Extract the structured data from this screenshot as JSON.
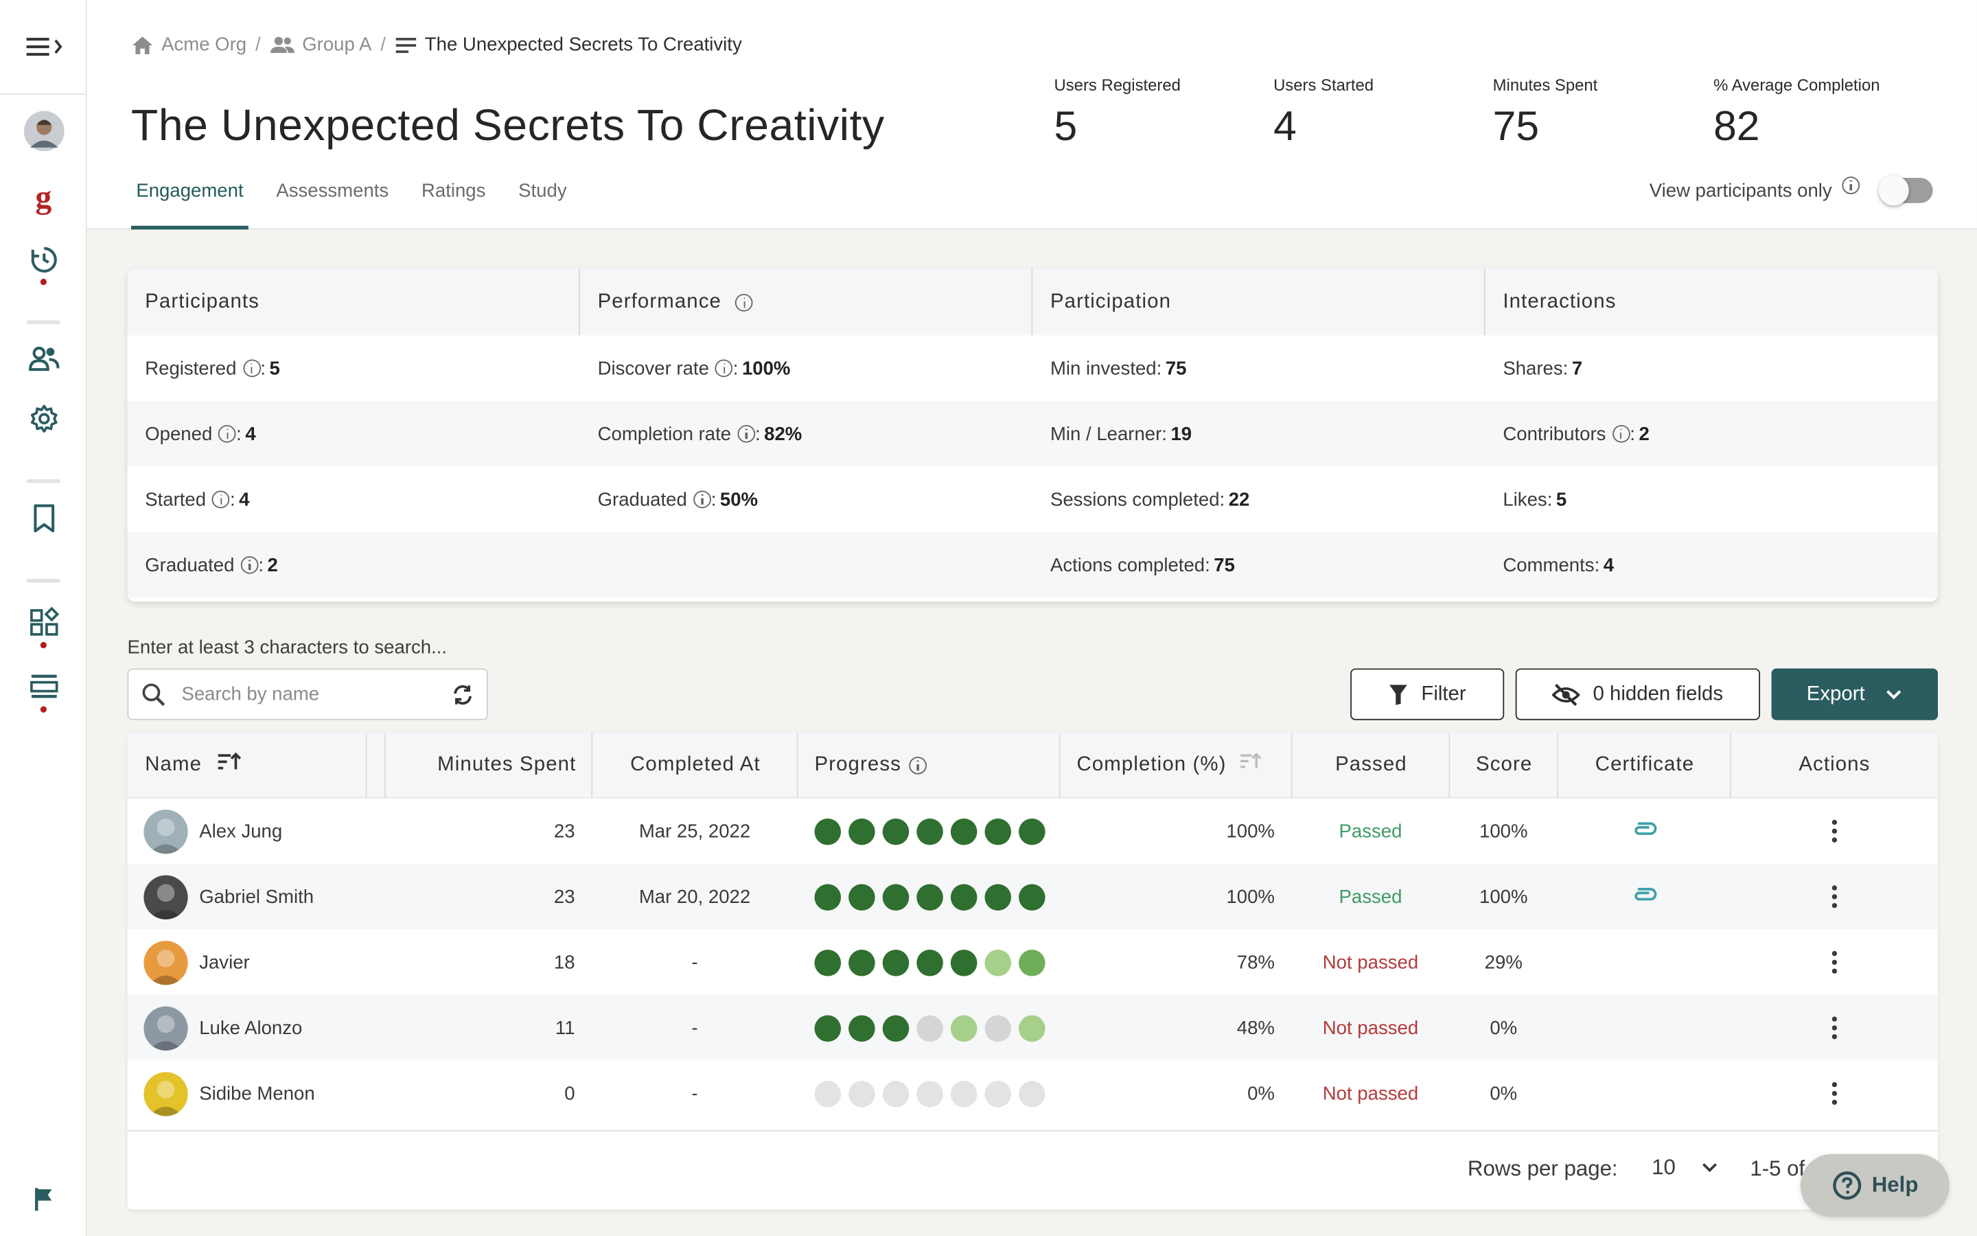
{
  "breadcrumb": [
    {
      "label": "Acme Org",
      "icon": "home-icon"
    },
    {
      "label": "Group A",
      "icon": "group-icon"
    },
    {
      "label": "The Unexpected Secrets To Creativity",
      "icon": "lines-icon"
    }
  ],
  "page": {
    "title": "The Unexpected Secrets To Creativity"
  },
  "stats": [
    {
      "label": "Users Registered",
      "value": "5"
    },
    {
      "label": "Users Started",
      "value": "4"
    },
    {
      "label": "Minutes Spent",
      "value": "75"
    },
    {
      "label": "% Average Completion",
      "value": "82"
    }
  ],
  "tabs": [
    {
      "label": "Engagement",
      "active": true
    },
    {
      "label": "Assessments",
      "active": false
    },
    {
      "label": "Ratings",
      "active": false
    },
    {
      "label": "Study",
      "active": false
    }
  ],
  "toggle": {
    "label": "View participants only",
    "on": false
  },
  "summary": {
    "columns": [
      "Participants",
      "Performance",
      "Participation",
      "Interactions"
    ],
    "rows": [
      [
        {
          "label": "Registered",
          "info": true,
          "sep": ": ",
          "value": "5"
        },
        {
          "label": "Discover rate",
          "info": true,
          "sep": ": ",
          "value": "100%"
        },
        {
          "label": "Min invested",
          "info": false,
          "sep": ": ",
          "value": "75"
        },
        {
          "label": "Shares",
          "info": false,
          "sep": ": ",
          "value": "7"
        }
      ],
      [
        {
          "label": "Opened",
          "info": true,
          "sep": ": ",
          "value": "4"
        },
        {
          "label": "Completion rate",
          "info": true,
          "sep": ": ",
          "value": "82%"
        },
        {
          "label": "Min / Learner",
          "info": false,
          "sep": ": ",
          "value": "19"
        },
        {
          "label": "Contributors",
          "info": true,
          "sep": ": ",
          "value": "2"
        }
      ],
      [
        {
          "label": "Started",
          "info": true,
          "sep": ": ",
          "value": "4"
        },
        {
          "label": "Graduated",
          "info": true,
          "sep": ": ",
          "value": "50%"
        },
        {
          "label": "Sessions completed",
          "info": false,
          "sep": ": ",
          "value": "22"
        },
        {
          "label": "Likes",
          "info": false,
          "sep": ": ",
          "value": "5"
        }
      ],
      [
        {
          "label": "Graduated",
          "info": true,
          "sep": ": ",
          "value": "2"
        },
        null,
        {
          "label": "Actions completed",
          "info": false,
          "sep": ": ",
          "value": "75"
        },
        {
          "label": "Comments",
          "info": false,
          "sep": ": ",
          "value": "4"
        }
      ]
    ]
  },
  "search": {
    "hint": "Enter at least 3 characters to search...",
    "placeholder": "Search by name",
    "value": ""
  },
  "toolbar": {
    "filter_label": "Filter",
    "hidden_fields_label": "0 hidden fields",
    "export_label": "Export"
  },
  "table": {
    "headers": {
      "name": "Name",
      "minutes": "Minutes Spent",
      "completed_at": "Completed At",
      "progress": "Progress",
      "completion": "Completion (%)",
      "passed": "Passed",
      "score": "Score",
      "certificate": "Certificate",
      "actions": "Actions"
    },
    "rows": [
      {
        "name": "Alex Jung",
        "minutes": "23",
        "completed_at": "Mar 25, 2022",
        "progress": [
          "d",
          "d",
          "d",
          "d",
          "d",
          "d",
          "d"
        ],
        "completion": "100%",
        "passed": "Passed",
        "passed_ok": true,
        "score": "100%",
        "certificate": true,
        "avatar_color": "#9fb0b8"
      },
      {
        "name": "Gabriel Smith",
        "minutes": "23",
        "completed_at": "Mar 20, 2022",
        "progress": [
          "d",
          "d",
          "d",
          "d",
          "d",
          "d",
          "d"
        ],
        "completion": "100%",
        "passed": "Passed",
        "passed_ok": true,
        "score": "100%",
        "certificate": true,
        "avatar_color": "#4a4a4a"
      },
      {
        "name": "Javier",
        "minutes": "18",
        "completed_at": "-",
        "progress": [
          "d",
          "d",
          "d",
          "d",
          "d",
          "l",
          "m"
        ],
        "completion": "78%",
        "passed": "Not passed",
        "passed_ok": false,
        "score": "29%",
        "certificate": false,
        "avatar_color": "#e79a3e"
      },
      {
        "name": "Luke Alonzo",
        "minutes": "11",
        "completed_at": "-",
        "progress": [
          "d",
          "d",
          "d",
          "g",
          "l",
          "g",
          "l"
        ],
        "completion": "48%",
        "passed": "Not passed",
        "passed_ok": false,
        "score": "0%",
        "certificate": false,
        "avatar_color": "#8c98a3"
      },
      {
        "name": "Sidibe Menon",
        "minutes": "0",
        "completed_at": "-",
        "progress": [
          "e",
          "e",
          "e",
          "e",
          "e",
          "e",
          "e"
        ],
        "completion": "0%",
        "passed": "Not passed",
        "passed_ok": false,
        "score": "0%",
        "certificate": false,
        "avatar_color": "#e3c22a"
      }
    ],
    "progress_colors": {
      "d": "#2f6f2f",
      "m": "#6fae58",
      "l": "#a6cf8a",
      "g": "#d5d5d5",
      "e": "#e3e3e3"
    }
  },
  "pagination": {
    "rows_per_page_label": "Rows per page:",
    "rows_per_page": "10",
    "range": "1-5 of"
  },
  "help": {
    "label": "Help"
  },
  "colors": {
    "accent": "#2a5c60",
    "passed": "#3e9b64",
    "not_passed": "#b33a3a",
    "sidebar_dot": "#b41f1f"
  }
}
